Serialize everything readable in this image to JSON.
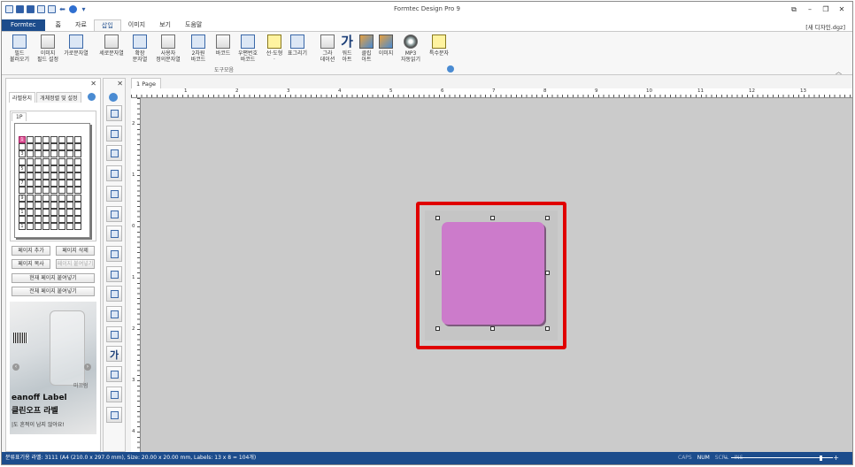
{
  "window": {
    "title": "Formtec Design Pro 9",
    "filename": "[새 디자인.dgz]"
  },
  "ribbon": {
    "tabs": [
      "Formtec",
      "홈",
      "자료",
      "삽입",
      "이미지",
      "보기",
      "도움말"
    ],
    "active_tab": "삽입",
    "group_label": "도구모음",
    "buttons": [
      {
        "label": "필드\n불러오기",
        "icon": "field-check-icon"
      },
      {
        "label": "이미지\n필드 설정",
        "icon": "image-field-icon"
      },
      {
        "label": "가로문자열",
        "icon": "horizontal-text-icon"
      },
      {
        "label": "세로문자열",
        "icon": "vertical-text-icon"
      },
      {
        "label": "확장\n문자열",
        "icon": "extended-text-icon"
      },
      {
        "label": "사용자\n정의문자열",
        "icon": "custom-text-icon"
      },
      {
        "label": "2차원\n바코드",
        "icon": "qr-code-icon"
      },
      {
        "label": "바코드",
        "icon": "barcode-icon"
      },
      {
        "label": "우편번호\n바코드",
        "icon": "postal-barcode-icon"
      },
      {
        "label": "선·도형\n·",
        "icon": "shape-icon"
      },
      {
        "label": "표그리기",
        "icon": "table-icon"
      },
      {
        "label": "그라\n데이션",
        "icon": "gradient-icon"
      },
      {
        "label": "워드\n아트",
        "icon": "wordart-icon"
      },
      {
        "label": "클립\n아트",
        "icon": "clipart-icon"
      },
      {
        "label": "이미지",
        "icon": "image-icon"
      },
      {
        "label": "MP3\n자동읽기",
        "icon": "mp3-cd-icon"
      },
      {
        "label": "특수문자",
        "icon": "special-char-icon"
      }
    ]
  },
  "left_panel": {
    "tabs": [
      "라벨용지",
      "개체정렬 및 설정"
    ],
    "page_tab": "1P",
    "row_numbers": [
      "1",
      "",
      "3",
      "",
      "5",
      "",
      "7",
      "",
      "9",
      "",
      "1",
      "",
      "1"
    ],
    "buttons": {
      "add_page": "페이지 추가",
      "delete_page": "페이지 삭제",
      "copy_page": "페이지 복사",
      "paste_page": "페이지 붙여넣기",
      "paste_current": "현재 페이지 붙여넣기",
      "paste_all": "전체 페이지 붙여넣기"
    },
    "ad": {
      "logo": "eanoff Label",
      "title": "클린오프 라벨",
      "subtitle": "|도 흔적이 남지 않아요!",
      "tag": "미끄럼"
    }
  },
  "document": {
    "tab": "1 Page",
    "hruler_numbers": [
      "1",
      "2",
      "3",
      "4",
      "5",
      "6",
      "7",
      "8",
      "9",
      "10",
      "11",
      "12",
      "13"
    ],
    "vruler_numbers": [
      "2",
      "1",
      "0",
      "1",
      "2",
      "3",
      "4"
    ]
  },
  "status": {
    "text": "분류표기용 라벨: 3111 (A4 (210.0 x 297.0 mm), Size: 20.00 x 20.00 mm, Labels: 13 x 8 = 104개)",
    "flags": [
      "CAPS",
      "NUM",
      "SCRL",
      "INS"
    ],
    "active_flags": [
      "NUM"
    ]
  },
  "colors": {
    "accent": "#1c4c8c",
    "label_fill": "#cc7bcb",
    "highlight": "#e00000"
  }
}
